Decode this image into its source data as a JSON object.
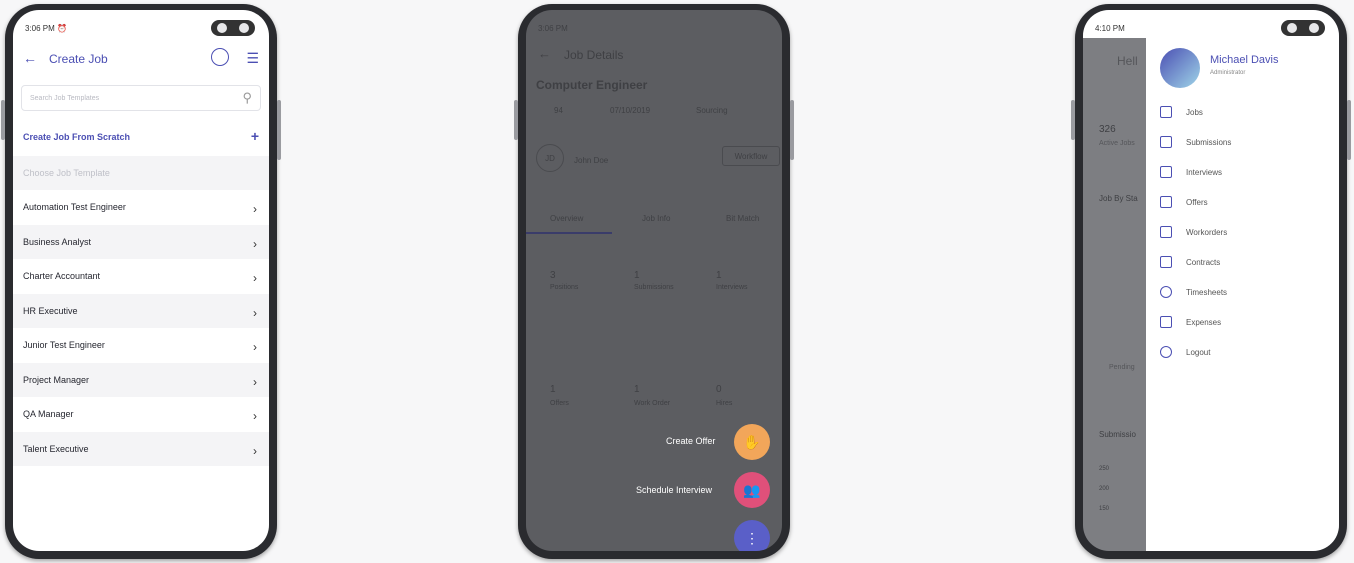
{
  "phone1": {
    "status_time": "3:06 PM",
    "title": "Create Job",
    "search_placeholder": "Search Job Templates",
    "create_scratch": "Create Job From Scratch",
    "choose_template": "Choose Job Template",
    "templates": [
      "Automation Test Engineer",
      "Business Analyst",
      "Charter Accountant",
      "HR Executive",
      "Junior Test Engineer",
      "Project Manager",
      "QA Manager",
      "Talent Executive"
    ]
  },
  "phone2": {
    "status_time": "3:06 PM",
    "title": "Job Details",
    "job_title": "Computer Engineer",
    "job_id": "94",
    "job_date": "07/10/2019",
    "status": "Sourcing",
    "recruiter_initials": "JD",
    "recruiter_name": "John Doe",
    "workflow_btn": "Workflow",
    "tabs": [
      "Overview",
      "Job Info",
      "Bit Match"
    ],
    "stats_row1": [
      {
        "value": "3",
        "label": "Positions"
      },
      {
        "value": "1",
        "label": "Submissions"
      },
      {
        "value": "1",
        "label": "Interviews"
      }
    ],
    "stats_row2": [
      {
        "value": "1",
        "label": "Offers"
      },
      {
        "value": "1",
        "label": "Work Order"
      },
      {
        "value": "0",
        "label": "Hires"
      }
    ],
    "fab_create_offer": "Create Offer",
    "fab_schedule_interview": "Schedule Interview",
    "fab_more": "⋮"
  },
  "phone3": {
    "status_time": "4:10 PM",
    "greeting": "Hell",
    "active_jobs_value": "326",
    "active_jobs_label": "Active Jobs",
    "job_by_status": "Job By Sta",
    "legend": "Pending",
    "submissions_label": "Submissio",
    "axis_ticks": [
      "250",
      "200",
      "150"
    ],
    "user_name": "Michael Davis",
    "user_role": "Administrator",
    "menu": [
      "Jobs",
      "Submissions",
      "Interviews",
      "Offers",
      "Workorders",
      "Contracts",
      "Timesheets",
      "Expenses",
      "Logout"
    ]
  },
  "colors": {
    "accent": "#4b4fb3",
    "orange": "#f2a65a",
    "pink": "#e0507a",
    "purple": "#5a5fc8"
  }
}
